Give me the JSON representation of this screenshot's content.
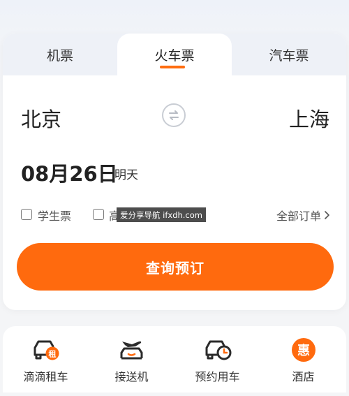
{
  "tabs": [
    {
      "label": "机票",
      "active": false
    },
    {
      "label": "火车票",
      "active": true
    },
    {
      "label": "汽车票",
      "active": false
    }
  ],
  "route": {
    "from": "北京",
    "to": "上海",
    "swap_icon": "swap-arrows-icon"
  },
  "date": {
    "value": "08月26日",
    "relative": "明天"
  },
  "options": {
    "student_ticket": "学生票",
    "second_option_partial": "高",
    "all_orders": "全部订单"
  },
  "watermark": "爱分享导航 ifxdh.com",
  "search_button": "查询预订",
  "services": [
    {
      "label": "滴滴租车",
      "icon": "car-rental-icon",
      "badge": "租"
    },
    {
      "label": "接送机",
      "icon": "airport-transfer-icon"
    },
    {
      "label": "预约用车",
      "icon": "scheduled-car-icon"
    },
    {
      "label": "酒店",
      "icon": "hotel-discount-icon",
      "badge": "惠"
    }
  ],
  "colors": {
    "accent": "#ff6a0e",
    "text": "#222222",
    "muted": "#555555"
  }
}
